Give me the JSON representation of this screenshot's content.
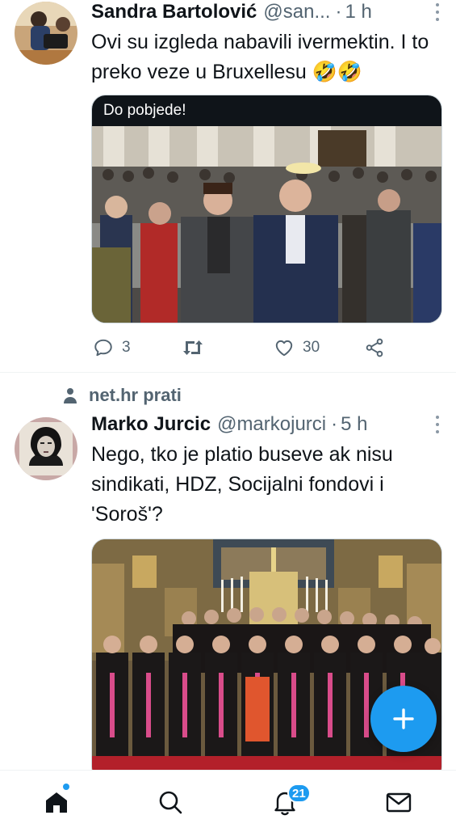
{
  "tweets": [
    {
      "author_name": "Sandra Bartolović",
      "handle": "@san...",
      "time": "1 h",
      "text": "Ovi su izgleda nabavili ivermektin. I to preko veze u Bruxellesu 🤣🤣",
      "media_caption": "Do pobjede!",
      "replies": "3",
      "retweets": "",
      "likes": "30"
    },
    {
      "social_context": "net.hr prati",
      "author_name": "Marko Jurcic",
      "handle": "@markojurci",
      "time": "5 h",
      "text": "Nego, tko je platio buseve ak nisu sindikati, HDZ, Socijalni fondovi i 'Soroš'?"
    }
  ],
  "nav": {
    "notifications_badge": "21",
    "items": [
      "home-icon",
      "search-icon",
      "bell-icon",
      "mail-icon"
    ]
  },
  "colors": {
    "accent": "#1d9bf0",
    "text": "#0f1419",
    "secondary": "#536471"
  }
}
